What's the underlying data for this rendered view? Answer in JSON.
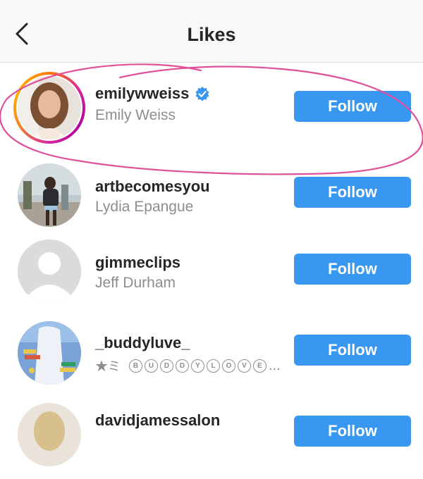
{
  "header": {
    "title": "Likes",
    "back_icon": "chevron-left-icon"
  },
  "colors": {
    "accent": "#3897f0",
    "annotation": "#e0509a",
    "verified": "#3897f0"
  },
  "users": [
    {
      "username": "emilywweiss",
      "full_name": "Emily Weiss",
      "verified": true,
      "story_ring": true,
      "follow_label": "Follow"
    },
    {
      "username": "artbecomesyou",
      "full_name": "Lydia Epangue",
      "verified": false,
      "follow_label": "Follow"
    },
    {
      "username": "gimmeclips",
      "full_name": "Jeff Durham",
      "verified": false,
      "default_avatar": true,
      "follow_label": "Follow"
    },
    {
      "username": "_buddyluve_",
      "full_name_prefix": "★ミ",
      "full_name_letters": [
        "B",
        "U",
        "D",
        "D",
        "Y",
        "L",
        "O",
        "V",
        "E"
      ],
      "full_name_suffix": "...",
      "verified": false,
      "follow_label": "Follow"
    },
    {
      "username": "davidjamessalon",
      "verified": false,
      "follow_label": "Follow"
    }
  ]
}
